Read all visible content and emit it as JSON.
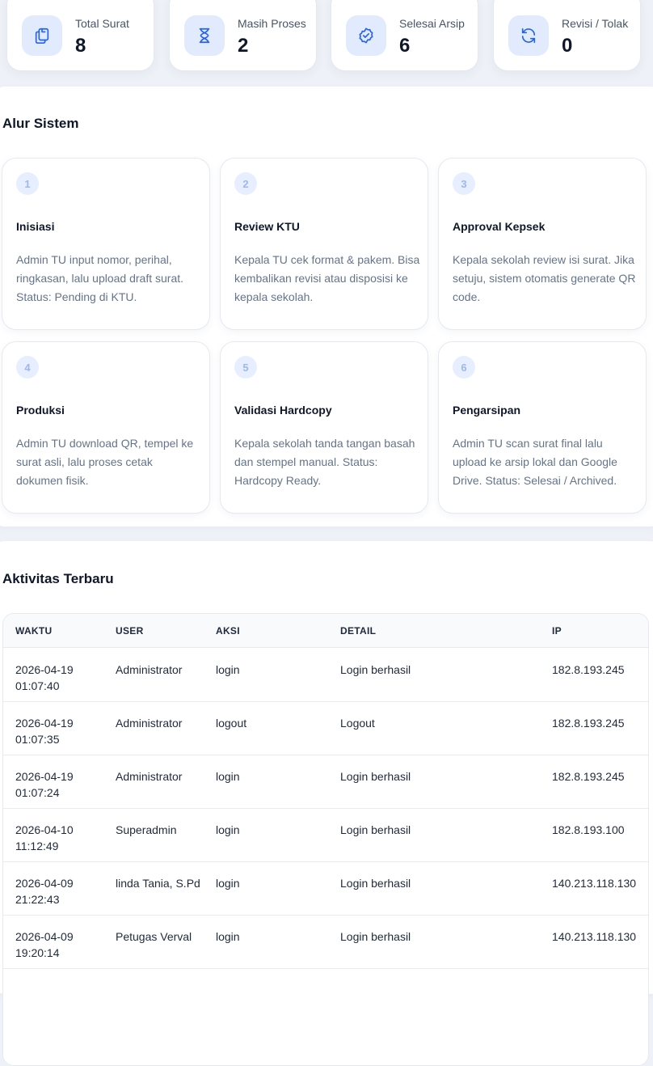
{
  "stats": [
    {
      "label": "Total Surat",
      "value": "8",
      "icon": "documents-icon"
    },
    {
      "label": "Masih Proses",
      "value": "2",
      "icon": "hourglass-icon"
    },
    {
      "label": "Selesai Arsip",
      "value": "6",
      "icon": "check-badge-icon"
    },
    {
      "label": "Revisi / Tolak",
      "value": "0",
      "icon": "refresh-icon"
    }
  ],
  "colors": {
    "accent": "#2563eb",
    "icon_bg": "#e1ebfd",
    "muted_text": "#64748b"
  },
  "flow": {
    "title": "Alur Sistem",
    "steps": [
      {
        "number": "1",
        "title": "Inisiasi",
        "desc": "Admin TU input nomor, perihal, ringkasan, lalu upload draft surat. Status: Pending di KTU."
      },
      {
        "number": "2",
        "title": "Review KTU",
        "desc": "Kepala TU cek format & pakem. Bisa kembalikan revisi atau disposisi ke kepala sekolah."
      },
      {
        "number": "3",
        "title": "Approval Kepsek",
        "desc": "Kepala sekolah review isi surat. Jika setuju, sistem otomatis generate QR code."
      },
      {
        "number": "4",
        "title": "Produksi",
        "desc": "Admin TU download QR, tempel ke surat asli, lalu proses cetak dokumen fisik."
      },
      {
        "number": "5",
        "title": "Validasi Hardcopy",
        "desc": "Kepala sekolah tanda tangan basah dan stempel manual. Status: Hardcopy Ready."
      },
      {
        "number": "6",
        "title": "Pengarsipan",
        "desc": "Admin TU scan surat final lalu upload ke arsip lokal dan Google Drive. Status: Selesai / Archived."
      }
    ]
  },
  "activity": {
    "title": "Aktivitas Terbaru",
    "columns": [
      "WAKTU",
      "USER",
      "AKSI",
      "DETAIL",
      "IP"
    ],
    "rows": [
      {
        "waktu": "2026-04-19 01:07:40",
        "user": "Administrator",
        "aksi": "login",
        "detail": "Login berhasil",
        "ip": "182.8.193.245"
      },
      {
        "waktu": "2026-04-19 01:07:35",
        "user": "Administrator",
        "aksi": "logout",
        "detail": "Logout",
        "ip": "182.8.193.245"
      },
      {
        "waktu": "2026-04-19 01:07:24",
        "user": "Administrator",
        "aksi": "login",
        "detail": "Login berhasil",
        "ip": "182.8.193.245"
      },
      {
        "waktu": "2026-04-10 11:12:49",
        "user": "Superadmin",
        "aksi": "login",
        "detail": "Login berhasil",
        "ip": "182.8.193.100"
      },
      {
        "waktu": "2026-04-09 21:22:43",
        "user": "linda Tania, S.Pd",
        "aksi": "login",
        "detail": "Login berhasil",
        "ip": "140.213.118.130"
      },
      {
        "waktu": "2026-04-09 19:20:14",
        "user": "Petugas Verval",
        "aksi": "login",
        "detail": "Login berhasil",
        "ip": "140.213.118.130"
      }
    ]
  }
}
